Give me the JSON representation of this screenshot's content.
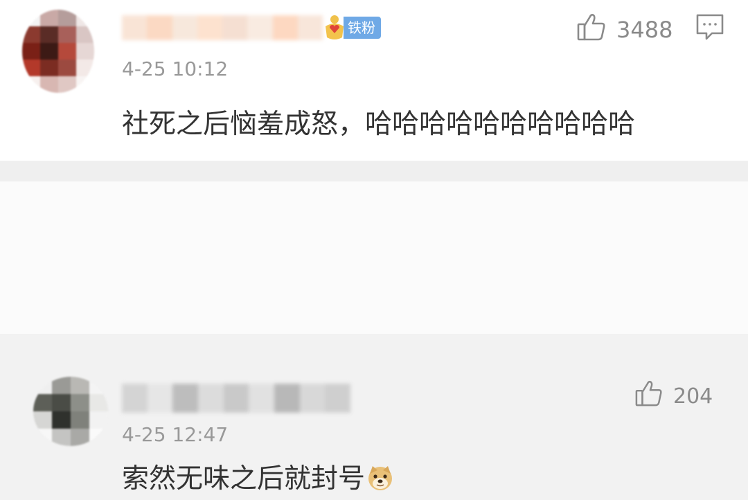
{
  "comments": [
    {
      "badge": "铁粉",
      "time": "4-25 10:12",
      "text": "社死之后恼羞成怒，哈哈哈哈哈哈哈哈哈哈",
      "likes": "3488",
      "avatar_colors": [
        "#f4f4f4",
        "#c9a9a6",
        "#b59d9b",
        "#efe7e6",
        "#8b3a2f",
        "#5a2c26",
        "#a8605a",
        "#d9c6c4",
        "#7a2016",
        "#3c1a15",
        "#b5493b",
        "#e6d7d5",
        "#b3392a",
        "#7b2c22",
        "#9c4a40",
        "#f3e9e7",
        "#f7f0ee",
        "#d8b7b2",
        "#e0c8c4",
        "#f8f4f3"
      ],
      "username_colors": [
        "#f9e4d6",
        "#fbd9c3",
        "#f7e8dc",
        "#fde2cf",
        "#f5dfd2",
        "#f9ebe1",
        "#fdd8c1",
        "#f8e6da"
      ]
    },
    {
      "time": "4-25 12:47",
      "text": "索然无味之后就封号",
      "likes": "204",
      "emoji": "doge-emoji",
      "avatar_colors": [
        "#efefef",
        "#9a9a96",
        "#b9b8b4",
        "#f4f4f4",
        "#5d5f58",
        "#4a4c46",
        "#8d8f89",
        "#e8e8e6",
        "#d6d6d4",
        "#2f312d",
        "#7f817b",
        "#f2f2f2",
        "#f7f7f7",
        "#c4c4c2",
        "#a9a9a6",
        "#fafafa"
      ],
      "username_colors": [
        "#d4d4d4",
        "#e6e6e6",
        "#bdbdbd",
        "#dcdcdc",
        "#c9c9c9",
        "#e1e1e1",
        "#b8b8b8",
        "#d8d8d8",
        "#cfcfcf"
      ]
    }
  ],
  "colors": {
    "background": "#f2f2f2",
    "badge": "#6fa9e6",
    "muted_text": "#999999",
    "icon": "#8a8a8a"
  }
}
